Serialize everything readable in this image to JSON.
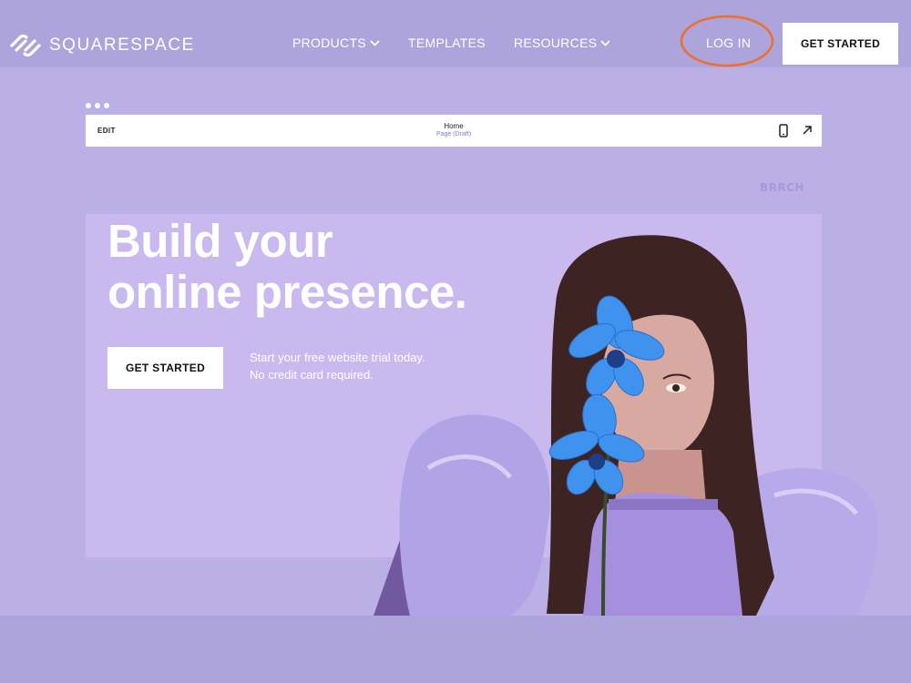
{
  "nav": {
    "brand": "SQUARESPACE",
    "items": [
      {
        "label": "PRODUCTS"
      },
      {
        "label": "TEMPLATES"
      },
      {
        "label": "RESOURCES"
      }
    ],
    "login": "LOG IN",
    "cta": "GET STARTED"
  },
  "editor": {
    "edit_label": "EDIT",
    "page_name": "Home",
    "page_status": "Page (Draft)"
  },
  "hero": {
    "brand": "BRRCH",
    "headline_line1": "Build your",
    "headline_line2": "online presence.",
    "cta": "GET STARTED",
    "sub_line1": "Start your free website trial today.",
    "sub_line2": "No credit card required."
  },
  "icons": {
    "logo": "squarespace-logo-icon",
    "chevron": "chevron-down-icon",
    "mobile": "mobile-preview-icon",
    "exit": "arrow-up-right-icon",
    "more": "more-dots-icon"
  },
  "colors": {
    "background": "#bbb0e6",
    "outer_band": "#aca4db",
    "canvas": "#c9b9ee",
    "highlight_ring": "#e8722e",
    "orchid": "#3f93ee",
    "button": "#ffffff"
  }
}
